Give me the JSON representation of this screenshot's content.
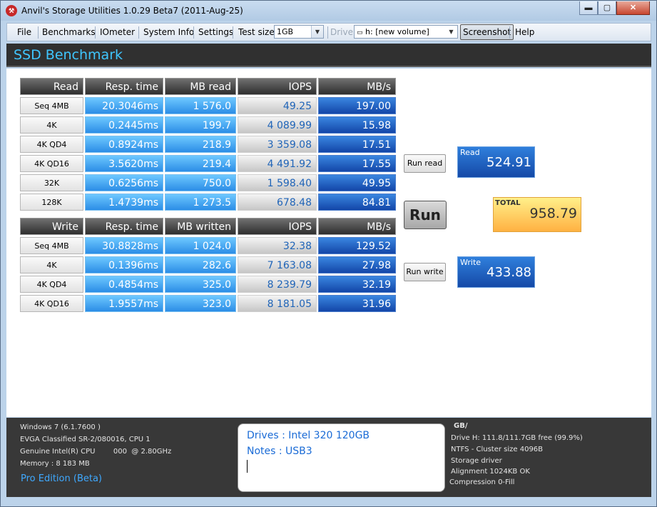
{
  "window": {
    "title": "Anvil's Storage Utilities 1.0.29 Beta7 (2011-Aug-25)",
    "app_icon": "anvil-icon",
    "controls": {
      "minimize": "▬",
      "maximize": "▢",
      "close": "✕"
    }
  },
  "toolbar": {
    "file": "File",
    "benchmarks": "Benchmarks",
    "iometer": "IOmeter",
    "system_info": "System Info",
    "settings": "Settings",
    "test_size_label": "Test size",
    "test_size_value": "1GB",
    "drive_label": "Drive",
    "drive_value": "h: [new volume]",
    "screenshot": "Screenshot",
    "help": "Help"
  },
  "header": {
    "title": "SSD Benchmark"
  },
  "read_table": {
    "headers": [
      "Read",
      "Resp. time",
      "MB read",
      "IOPS",
      "MB/s"
    ],
    "rows": [
      {
        "label": "Seq 4MB",
        "resp": "20.3046ms",
        "mb": "1 576.0",
        "iops": "49.25",
        "mbs": "197.00"
      },
      {
        "label": "4K",
        "resp": "0.2445ms",
        "mb": "199.7",
        "iops": "4 089.99",
        "mbs": "15.98"
      },
      {
        "label": "4K QD4",
        "resp": "0.8924ms",
        "mb": "218.9",
        "iops": "3 359.08",
        "mbs": "17.51"
      },
      {
        "label": "4K QD16",
        "resp": "3.5620ms",
        "mb": "219.4",
        "iops": "4 491.92",
        "mbs": "17.55"
      },
      {
        "label": "32K",
        "resp": "0.6256ms",
        "mb": "750.0",
        "iops": "1 598.40",
        "mbs": "49.95"
      },
      {
        "label": "128K",
        "resp": "1.4739ms",
        "mb": "1 273.5",
        "iops": "678.48",
        "mbs": "84.81"
      }
    ]
  },
  "write_table": {
    "headers": [
      "Write",
      "Resp. time",
      "MB written",
      "IOPS",
      "MB/s"
    ],
    "rows": [
      {
        "label": "Seq 4MB",
        "resp": "30.8828ms",
        "mb": "1 024.0",
        "iops": "32.38",
        "mbs": "129.52"
      },
      {
        "label": "4K",
        "resp": "0.1396ms",
        "mb": "282.6",
        "iops": "7 163.08",
        "mbs": "27.98"
      },
      {
        "label": "4K QD4",
        "resp": "0.4854ms",
        "mb": "325.0",
        "iops": "8 239.79",
        "mbs": "32.19"
      },
      {
        "label": "4K QD16",
        "resp": "1.9557ms",
        "mb": "323.0",
        "iops": "8 181.05",
        "mbs": "31.96"
      }
    ]
  },
  "buttons": {
    "run_read": "Run read",
    "run": "Run",
    "run_write": "Run write"
  },
  "scores": {
    "read_label": "Read",
    "read_value": "524.91",
    "total_label": "TOTAL",
    "total_value": "958.79",
    "write_label": "Write",
    "write_value": "433.88"
  },
  "system": {
    "os": "Windows 7 (6.1.7600 )",
    "board": "EVGA Classified SR-2/080016, CPU 1",
    "cpu": "Genuine Intel(R) CPU        000  @ 2.80GHz",
    "memory": "Memory : 8 183 MB",
    "edition": "Pro Edition (Beta)"
  },
  "notes": {
    "drives": "Drives : Intel 320 120GB",
    "notes": "Notes : USB3"
  },
  "drive_info": {
    "title": "GB/",
    "free": "Drive H: 111.8/111.7GB free (99.9%)",
    "fs": "NTFS - Cluster size 4096B",
    "driver": "Storage driver",
    "alignment": "Alignment 1024KB OK",
    "compression": "Compression 0-Fill"
  }
}
